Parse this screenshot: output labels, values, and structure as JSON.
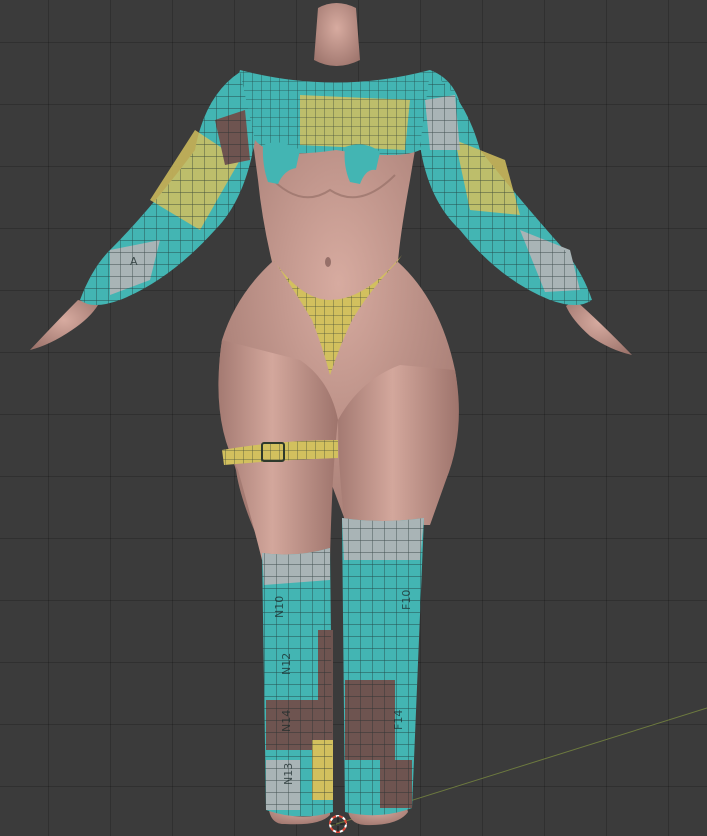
{
  "viewport": {
    "name": "3D Viewport",
    "background": "#3b3b3b",
    "grid_line": "#333333"
  },
  "model": {
    "skin_color": "#c69b91",
    "skin_shadow": "#8f6a63",
    "uv_colors": {
      "teal": "#43b5b3",
      "teal_light": "#7fd0cc",
      "yellow": "#d2c05e",
      "brown": "#6e5450",
      "grey": "#a9b4b6"
    }
  },
  "uv_labels": {
    "left_leg_1": "N10",
    "left_leg_2": "N12",
    "left_leg_3": "N14",
    "left_leg_4": "N13",
    "right_leg_1": "F10",
    "right_leg_2": "F14",
    "sleeve_1": "A"
  },
  "cursor": {
    "name": "3d-cursor",
    "color_a": "#e04b3a",
    "color_b": "#ffffff"
  }
}
